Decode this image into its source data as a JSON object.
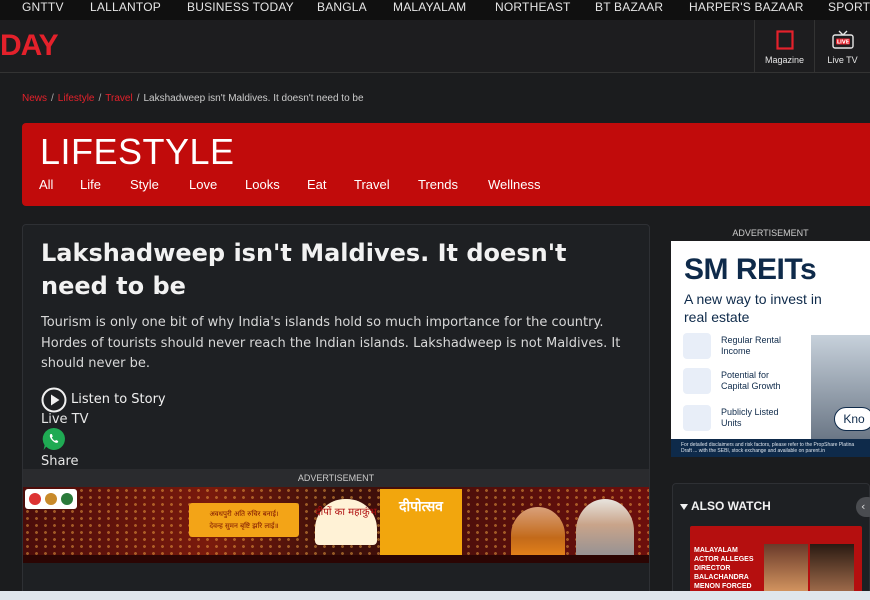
{
  "topnav": [
    "GNTTV",
    "LALLANTOP",
    "BUSINESS TODAY",
    "BANGLA",
    "MALAYALAM",
    "NORTHEAST",
    "BT BAZAAR",
    "HARPER'S BAZAAR",
    "SPORTS"
  ],
  "header": {
    "logo": "DAY",
    "magazine_label": "Magazine",
    "livetv_label": "Live TV",
    "accent": "#e4212b"
  },
  "breadcrumb": {
    "items": [
      "News",
      "Lifestyle",
      "Travel"
    ],
    "current": "Lakshadweep isn't Maldives. It doesn't need to be"
  },
  "section": {
    "title": "LIFESTYLE",
    "tabs": [
      "All",
      "Life",
      "Style",
      "Love",
      "Looks",
      "Eat",
      "Travel",
      "Trends",
      "Wellness"
    ],
    "color": "#c10b0b"
  },
  "article": {
    "headline": "Lakshadweep isn't Maldives. It doesn't need to be",
    "summary": "Tourism is only one bit of why India's islands hold so much importance for the country. Hordes of tourists should never reach the Indian islands. Lakshadweep is not Maldives. It should never be.",
    "listen_label": "Listen to Story",
    "livetv_label": "Live TV",
    "share_label": "Share",
    "advertisement_label": "ADVERTISEMENT"
  },
  "ad_banner": {
    "box_line1": "अवधपुरी अति रुचिर बनाई।",
    "box_line2": "देवन्ह सुमन बृष्टि झरि लाई॥",
    "deep_text": "दीपों का महाकुंभ",
    "festival_text": "दीपोत्सव"
  },
  "right_ad": {
    "label": "ADVERTISEMENT",
    "headline": "SM REITs",
    "subhead": "A new way to invest in real estate",
    "features": [
      "Regular Rental Income",
      "Potential for Capital Growth",
      "Publicly Listed Units"
    ],
    "cta": "Kno",
    "fine_print": "For detailed disclaimers and risk factors, please refer to the PropShare Platina Draft ... with the SEBI, stock exchange and available on parent.in"
  },
  "also_watch": {
    "title": "ALSO WATCH",
    "video_caption": "MALAYALAM ACTOR ALLEGES DIRECTOR BALACHANDRA MENON FORCED"
  }
}
